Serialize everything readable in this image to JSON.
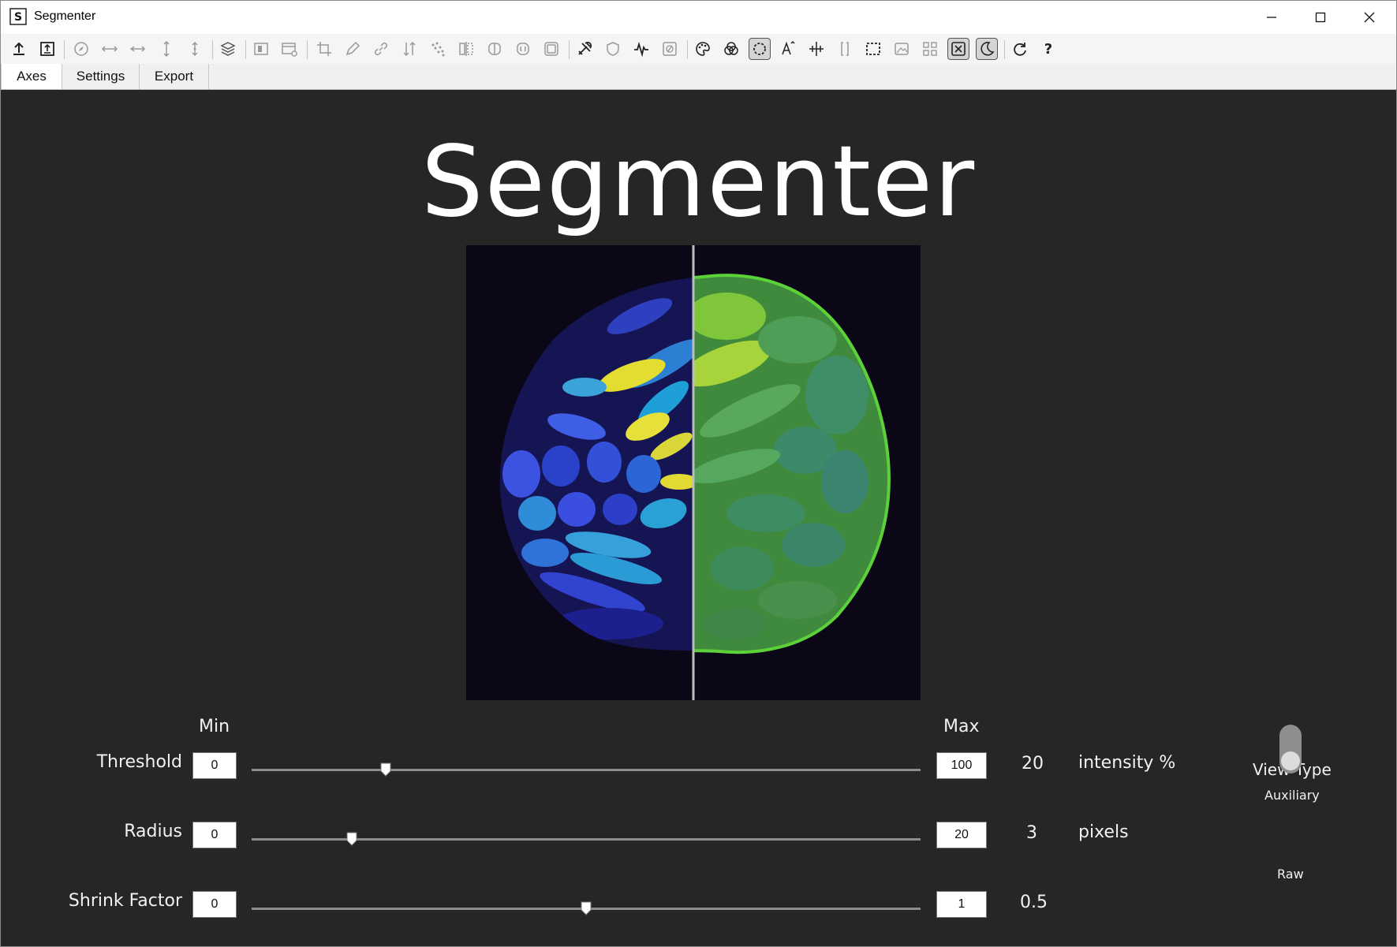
{
  "window": {
    "app_icon_glyph": "S",
    "title": "Segmenter"
  },
  "toolbar": {
    "icons": [
      "upload-icon",
      "upload-box-icon",
      "compass-icon",
      "horizontal-compress-icon",
      "horizontal-expand-icon",
      "vertical-compress-icon",
      "vertical-expand-icon",
      "layers-icon",
      "mask-icon",
      "window-settings-icon",
      "crop-icon",
      "pen-icon",
      "link-icon",
      "sort-icon",
      "scatter-icon",
      "flip-icon",
      "brain-icon",
      "brain-outline-icon",
      "frame-icon",
      "tools-icon",
      "shield-icon",
      "waveform-icon",
      "percent-box-icon",
      "palette-icon",
      "color-channels-icon",
      "circle-select-icon",
      "font-size-icon",
      "crosshair-icon",
      "bracket-icon",
      "rect-select-icon",
      "image-icon",
      "grid-icon",
      "close-box-icon",
      "dark-mode-icon",
      "refresh-icon",
      "help-icon"
    ],
    "help_label": "?"
  },
  "tabs": [
    {
      "label": "Axes",
      "active": true
    },
    {
      "label": "Settings",
      "active": false
    },
    {
      "label": "Export",
      "active": false
    }
  ],
  "main": {
    "title": "Segmenter",
    "min_label": "Min",
    "max_label": "Max",
    "controls": [
      {
        "label": "Threshold",
        "min": "0",
        "max": "100",
        "value": "20",
        "unit": "intensity %",
        "fraction": 0.2
      },
      {
        "label": "Radius",
        "min": "0",
        "max": "20",
        "value": "3",
        "unit": "pixels",
        "fraction": 0.15
      },
      {
        "label": "Shrink Factor",
        "min": "0",
        "max": "1",
        "value": "0.5",
        "unit": "",
        "fraction": 0.5
      }
    ],
    "view_type": {
      "title": "View Type",
      "top_option": "Auxiliary",
      "bottom_option": "Raw",
      "selected": "Raw"
    }
  },
  "colors": {
    "background": "#262626",
    "outline_green": "#5cd13a",
    "accent_yellow": "#e8e23a",
    "accent_blue": "#3d4fe0"
  }
}
